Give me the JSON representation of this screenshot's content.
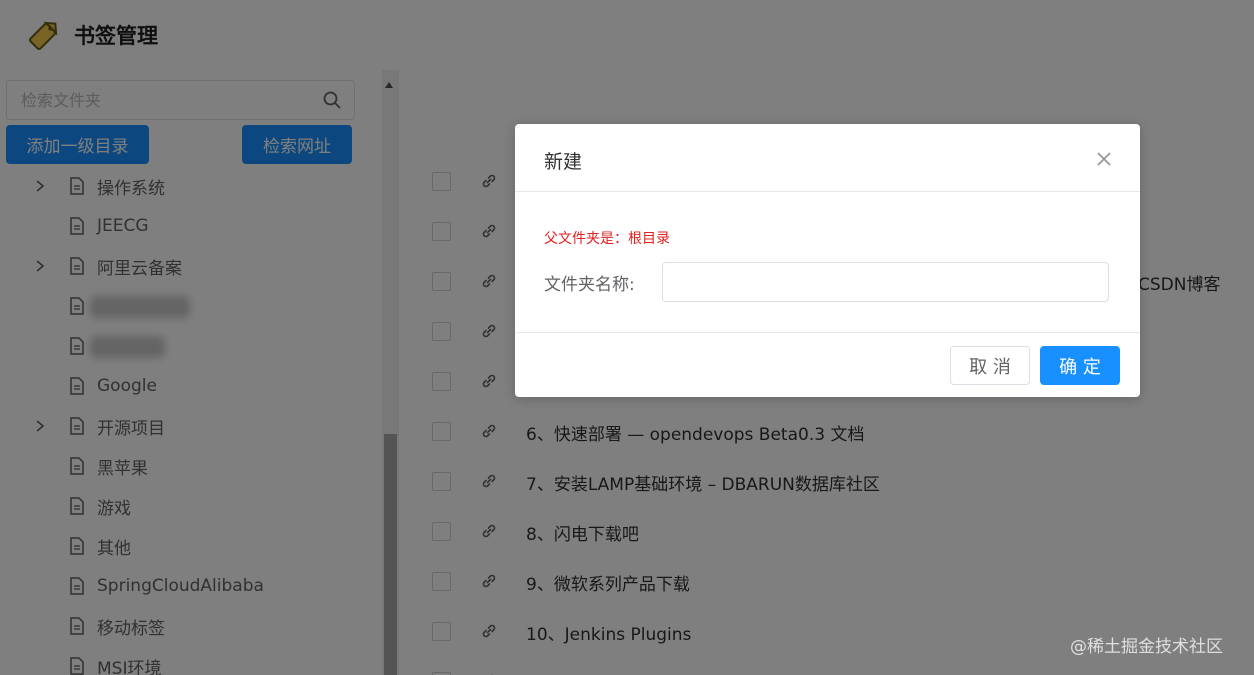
{
  "header": {
    "title": "书签管理",
    "logo_icon": "tag-icon"
  },
  "sidebar": {
    "search_placeholder": "检索文件夹",
    "add_root_button": "添加一级目录",
    "search_url_button": "检索网址",
    "items": [
      {
        "label": "操作系统",
        "expandable": true
      },
      {
        "label": "JEECG",
        "expandable": false
      },
      {
        "label": "阿里云备案",
        "expandable": true
      },
      {
        "label": "",
        "expandable": false,
        "blurred": true
      },
      {
        "label": "",
        "expandable": false,
        "blurred": true
      },
      {
        "label": "Google",
        "expandable": false
      },
      {
        "label": "开源项目",
        "expandable": true
      },
      {
        "label": "黑苹果",
        "expandable": false
      },
      {
        "label": "游戏",
        "expandable": false
      },
      {
        "label": "其他",
        "expandable": false
      },
      {
        "label": "SpringCloudAlibaba",
        "expandable": false
      },
      {
        "label": "移动标签",
        "expandable": false
      },
      {
        "label": "MSI环境",
        "expandable": false
      }
    ]
  },
  "main": {
    "partial_text": "CSDN博客",
    "rows": [
      {
        "text": ""
      },
      {
        "text": ""
      },
      {
        "text": ""
      },
      {
        "text": ""
      },
      {
        "text": ""
      },
      {
        "text": "6、快速部署 — opendevops Beta0.3 文档"
      },
      {
        "text": "7、安装LAMP基础环境 – DBARUN数据库社区"
      },
      {
        "text": "8、闪电下载吧"
      },
      {
        "text": "9、微软系列产品下载"
      },
      {
        "text": "10、Jenkins Plugins"
      },
      {
        "text": ""
      }
    ]
  },
  "dialog": {
    "title": "新建",
    "parent_info": "父文件夹是：根目录",
    "folder_name_label": "文件夹名称:",
    "folder_name_value": "",
    "cancel_label": "取 消",
    "ok_label": "确 定"
  },
  "watermark": "@稀土掘金技术社区",
  "colors": {
    "primary": "#1890ff",
    "danger_text": "#e02020",
    "mask": "rgba(0,0,0,0.5)"
  }
}
